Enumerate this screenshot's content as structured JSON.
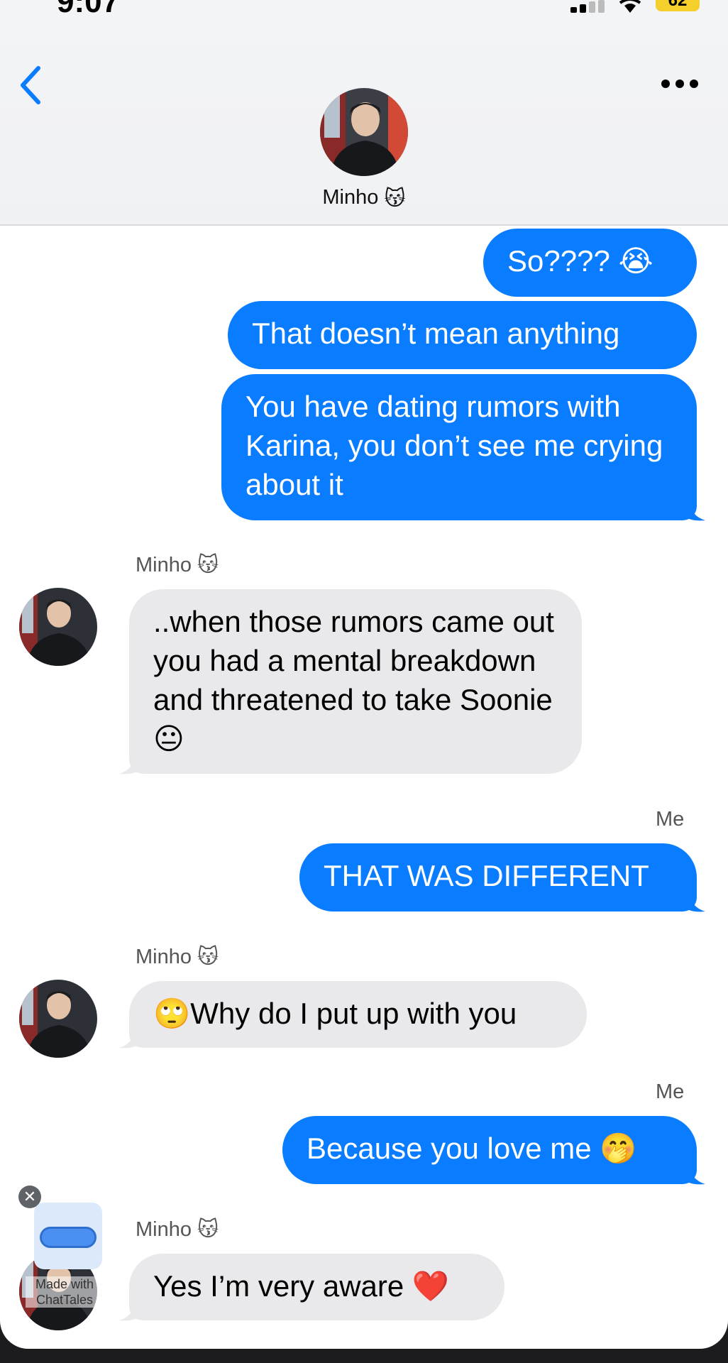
{
  "status_bar": {
    "time": "9:07",
    "battery": "62"
  },
  "header": {
    "contact_name": "Minho",
    "contact_emoji": "😽"
  },
  "messages": [
    {
      "text": "So???? 😭"
    },
    {
      "text": "That doesn’t mean anything"
    },
    {
      "text": "You have dating rumors with Karina, you don’t see me crying about it"
    },
    {
      "sender": "Minho 😽",
      "text": "..when those rumors came out you had a mental breakdown and threatened to take Soonie 😐"
    },
    {
      "sender": "Me",
      "text": "THAT WAS DIFFERENT"
    },
    {
      "sender": "Minho 😽",
      "text": "🙄Why do I put up with you"
    },
    {
      "sender": "Me",
      "text": "Because you love me 🤭"
    },
    {
      "sender": "Minho 😽",
      "text": "Yes I’m very aware ❤️"
    }
  ],
  "watermark": {
    "line1": "Made with",
    "line2": "ChatTales"
  },
  "colors": {
    "sent_bubble": "#0a7cff",
    "received_bubble": "#e9e9eb",
    "accent": "#0a7cff"
  }
}
